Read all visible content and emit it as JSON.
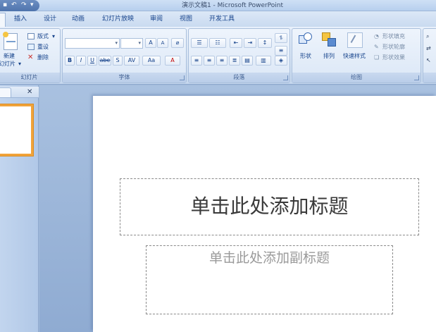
{
  "window": {
    "title": "演示文稿1 - Microsoft PowerPoint"
  },
  "tabs": [
    "插入",
    "设计",
    "动画",
    "幻灯片放映",
    "审阅",
    "视图",
    "开发工具"
  ],
  "ribbon": {
    "slides_group": {
      "label": "幻灯片",
      "new_slide_line1": "新建",
      "new_slide_line2": "幻灯片",
      "layout": "版式",
      "reset": "重设",
      "delete": "删除"
    },
    "font_group": {
      "label": "字体",
      "font_name_value": "",
      "font_size_value": "",
      "grow_font": "A",
      "shrink_font": "A",
      "bold": "B",
      "italic": "I",
      "underline": "U",
      "strikethrough": "abe",
      "shadow": "S",
      "char_spacing": "AV",
      "change_case": "Aa",
      "font_color": "A"
    },
    "paragraph_group": {
      "label": "段落"
    },
    "drawing_group": {
      "label": "绘图",
      "shapes": "形状",
      "arrange": "排列",
      "quick_styles": "快速样式",
      "shape_fill": "形状填充",
      "shape_outline": "形状轮廓",
      "shape_effects": "形状效果"
    }
  },
  "slide": {
    "title_placeholder": "单击此处添加标题",
    "subtitle_placeholder": "单击此处添加副标题"
  },
  "colors": {
    "accent_orange": "#f1a33a",
    "ribbon_text": "#15428b"
  }
}
